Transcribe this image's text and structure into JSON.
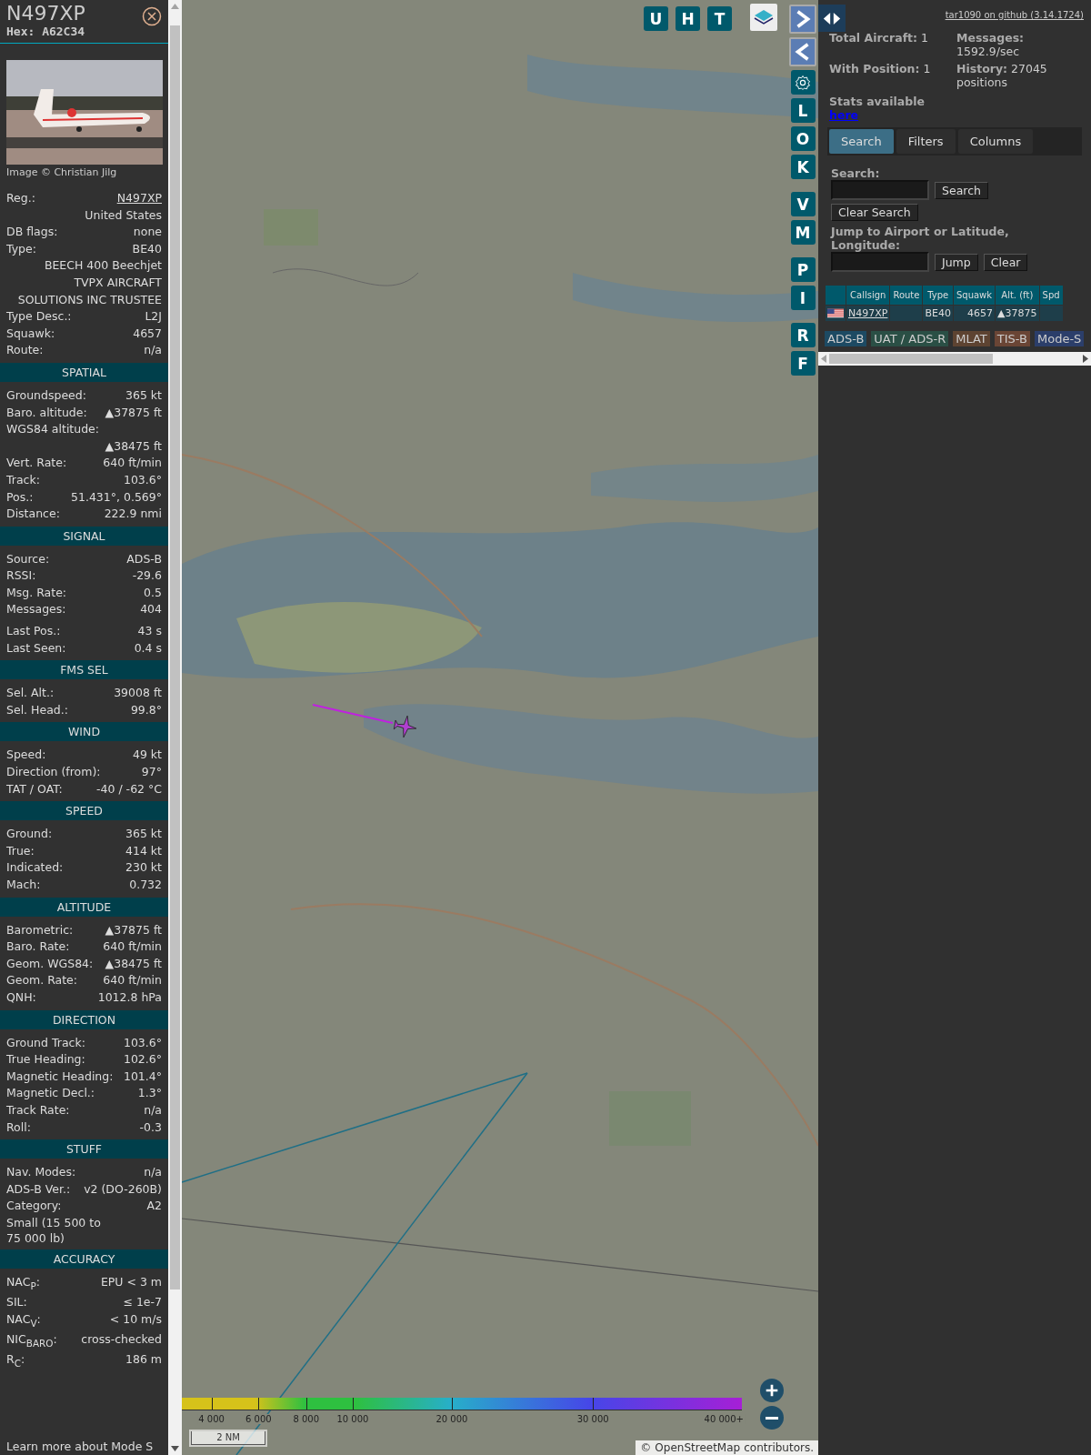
{
  "detail": {
    "title": "N497XP",
    "hex_label": "Hex:",
    "hex": "A62C34",
    "photo_credit": "Image © Christian Jilg",
    "info_rows": [
      {
        "kind": "link",
        "label": "Reg.:",
        "value": "N497XP"
      },
      {
        "kind": "value_only",
        "value": "United States"
      },
      {
        "kind": "pair",
        "label": "DB flags:",
        "value": "none"
      },
      {
        "kind": "pair",
        "label": "Type:",
        "value": "BE40"
      },
      {
        "kind": "value_only",
        "value": "BEECH 400 Beechjet"
      },
      {
        "kind": "value_only",
        "value": "TVPX AIRCRAFT SOLUTIONS INC TRUSTEE"
      },
      {
        "kind": "pair",
        "label": "Type Desc.:",
        "value": "L2J"
      },
      {
        "kind": "pair",
        "label": "Squawk:",
        "value": "4657"
      },
      {
        "kind": "pair",
        "label": "Route:",
        "value": "n/a"
      }
    ],
    "sections": [
      {
        "title": "SPATIAL",
        "rows": [
          {
            "kind": "pair",
            "label": "Groundspeed:",
            "value": "365 kt"
          },
          {
            "kind": "pair",
            "label": "Baro. altitude:",
            "value": "▲37875 ft"
          },
          {
            "kind": "wrap",
            "label": "WGS84 altitude:",
            "value": "▲38475 ft"
          },
          {
            "kind": "pair",
            "label": "Vert. Rate:",
            "value": "640 ft/min"
          },
          {
            "kind": "pair",
            "label": "Track:",
            "value": "103.6°"
          },
          {
            "kind": "pair",
            "label": "Pos.:",
            "value": "51.431°, 0.569°"
          },
          {
            "kind": "pair",
            "label": "Distance:",
            "value": "222.9 nmi"
          }
        ]
      },
      {
        "title": "SIGNAL",
        "rows": [
          {
            "kind": "pair",
            "label": "Source:",
            "value": "ADS-B"
          },
          {
            "kind": "pair",
            "label": "RSSI:",
            "value": "-29.6"
          },
          {
            "kind": "pair",
            "label": "Msg. Rate:",
            "value": "0.5"
          },
          {
            "kind": "pair",
            "label": "Messages:",
            "value": "404"
          },
          {
            "kind": "gap",
            "label": "Last Pos.:",
            "value": "43 s"
          },
          {
            "kind": "pair",
            "label": "Last Seen:",
            "value": "0.4 s"
          }
        ]
      },
      {
        "title": "FMS SEL",
        "rows": [
          {
            "kind": "pair",
            "label": "Sel. Alt.:",
            "value": "39008 ft"
          },
          {
            "kind": "pair",
            "label": "Sel. Head.:",
            "value": "99.8°"
          }
        ]
      },
      {
        "title": "WIND",
        "rows": [
          {
            "kind": "pair",
            "label": "Speed:",
            "value": "49 kt"
          },
          {
            "kind": "pair",
            "label": "Direction (from):",
            "value": "97°"
          },
          {
            "kind": "pair",
            "label": "TAT / OAT:",
            "value": "-40 / -62 °C"
          }
        ]
      },
      {
        "title": "SPEED",
        "rows": [
          {
            "kind": "pair",
            "label": "Ground:",
            "value": "365 kt"
          },
          {
            "kind": "pair",
            "label": "True:",
            "value": "414 kt"
          },
          {
            "kind": "pair",
            "label": "Indicated:",
            "value": "230 kt"
          },
          {
            "kind": "pair",
            "label": "Mach:",
            "value": "0.732"
          }
        ]
      },
      {
        "title": "ALTITUDE",
        "rows": [
          {
            "kind": "pair",
            "label": "Barometric:",
            "value": "▲37875 ft"
          },
          {
            "kind": "pair",
            "label": "Baro. Rate:",
            "value": "640 ft/min"
          },
          {
            "kind": "pair",
            "label": "Geom. WGS84:",
            "value": "▲38475 ft"
          },
          {
            "kind": "pair",
            "label": "Geom. Rate:",
            "value": "640 ft/min"
          },
          {
            "kind": "pair",
            "label": "QNH:",
            "value": "1012.8 hPa"
          }
        ]
      },
      {
        "title": "DIRECTION",
        "rows": [
          {
            "kind": "pair",
            "label": "Ground Track:",
            "value": "103.6°"
          },
          {
            "kind": "pair",
            "label": "True Heading:",
            "value": "102.6°"
          },
          {
            "kind": "pair",
            "label": "Magnetic Heading:",
            "value": "101.4°"
          },
          {
            "kind": "pair",
            "label": "Magnetic Decl.:",
            "value": "1.3°"
          },
          {
            "kind": "pair",
            "label": "Track Rate:",
            "value": "n/a"
          },
          {
            "kind": "pair",
            "label": "Roll:",
            "value": "-0.3"
          }
        ]
      },
      {
        "title": "STUFF",
        "rows": [
          {
            "kind": "pair",
            "label": "Nav. Modes:",
            "value": "n/a"
          },
          {
            "kind": "pair",
            "label": "ADS-B Ver.:",
            "value": "v2 (DO-260B)"
          },
          {
            "kind": "pair",
            "label": "Category:",
            "value": "A2"
          },
          {
            "kind": "note",
            "value": "Small (15 500 to 75 000 lb)"
          }
        ]
      },
      {
        "title": "ACCURACY",
        "rows": [
          {
            "kind": "pair",
            "label": "NAC$_{P}$:",
            "value": "EPU < 3 m"
          },
          {
            "kind": "pair",
            "label": "SIL:",
            "value": "≤ 1e-7"
          },
          {
            "kind": "pair",
            "label": "NAC$_{V}$:",
            "value": "< 10 m/s"
          },
          {
            "kind": "pair",
            "label": "NIC$_{BARO}$:",
            "value": "cross-checked"
          },
          {
            "kind": "pair",
            "label": "R$_{C}$:",
            "value": "186 m"
          }
        ]
      }
    ],
    "footer": "Learn more about Mode S"
  },
  "map": {
    "top_buttons": [
      "U",
      "H",
      "T"
    ],
    "side_buttons": [
      {
        "kind": "letter",
        "label": "L"
      },
      {
        "kind": "letter",
        "label": "O"
      },
      {
        "kind": "letter",
        "label": "K"
      },
      {
        "kind": "spacer"
      },
      {
        "kind": "letter",
        "label": "V"
      },
      {
        "kind": "letter",
        "label": "M"
      },
      {
        "kind": "spacer"
      },
      {
        "kind": "letter",
        "label": "P"
      },
      {
        "kind": "letter",
        "label": "I"
      },
      {
        "kind": "spacer"
      },
      {
        "kind": "letter",
        "label": "R"
      },
      {
        "kind": "letter",
        "label": "F"
      }
    ],
    "legend_ticks": [
      "4 000",
      "6 000",
      "8 000",
      "10 000",
      "20 000",
      "30 000",
      "40 000+"
    ],
    "scale": "2 NM",
    "attribution_prefix": "©",
    "attribution_link": "OpenStreetMap",
    "attribution_suffix": "contributors."
  },
  "panel": {
    "github_link": "tar1090 on github (3.14.1724)",
    "stats": [
      {
        "label": "Total Aircraft:",
        "value": "1"
      },
      {
        "label": "Messages:",
        "value": "1592.9/sec"
      },
      {
        "label": "With Position:",
        "value": "1"
      },
      {
        "label": "History:",
        "value": "27045 positions"
      }
    ],
    "stats_text": "Stats available",
    "stats_link": "here",
    "tabs": [
      {
        "label": "Search",
        "selected": true
      },
      {
        "label": "Filters",
        "selected": false
      },
      {
        "label": "Columns",
        "selected": false
      }
    ],
    "search_label": "Search:",
    "search_button": "Search",
    "clear_search_button": "Clear Search",
    "jump_label": "Jump to Airport or Latitude, Longitude:",
    "jump_button": "Jump",
    "clear_button": "Clear",
    "table": {
      "columns": [
        "Callsign",
        "Route",
        "Type",
        "Squawk",
        "Alt. (ft)",
        "Spd"
      ],
      "rows": [
        {
          "callsign": "N497XP",
          "route": "",
          "type": "BE40",
          "squawk": "4657",
          "altitude": "▲37875"
        }
      ]
    },
    "sources": [
      {
        "label": "ADS-B",
        "color": "#1d4a63"
      },
      {
        "label": "UAT / ADS-R",
        "color": "#2a4f45"
      },
      {
        "label": "MLAT",
        "color": "#5d4331"
      },
      {
        "label": "TIS-B",
        "color": "#6a4535"
      },
      {
        "label": "Mode-S",
        "color": "#2b3e6a"
      }
    ]
  }
}
